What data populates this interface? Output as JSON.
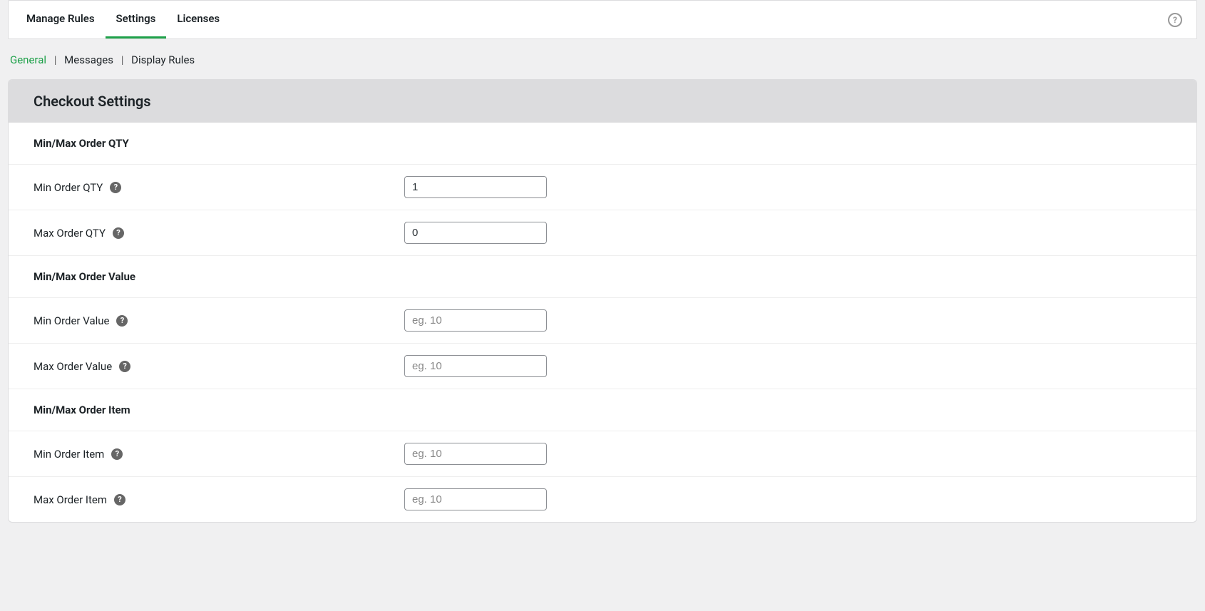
{
  "topTabs": {
    "manageRules": "Manage Rules",
    "settings": "Settings",
    "licenses": "Licenses"
  },
  "subTabs": {
    "general": "General",
    "messages": "Messages",
    "displayRules": "Display Rules"
  },
  "panel": {
    "title": "Checkout Settings"
  },
  "sections": {
    "qty": {
      "title": "Min/Max Order QTY",
      "min": {
        "label": "Min Order QTY",
        "value": "1"
      },
      "max": {
        "label": "Max Order QTY",
        "value": "0"
      }
    },
    "value": {
      "title": "Min/Max Order Value",
      "min": {
        "label": "Min Order Value",
        "placeholder": "eg. 10"
      },
      "max": {
        "label": "Max Order Value",
        "placeholder": "eg. 10"
      }
    },
    "item": {
      "title": "Min/Max Order Item",
      "min": {
        "label": "Min Order Item",
        "placeholder": "eg. 10"
      },
      "max": {
        "label": "Max Order Item",
        "placeholder": "eg. 10"
      }
    }
  }
}
